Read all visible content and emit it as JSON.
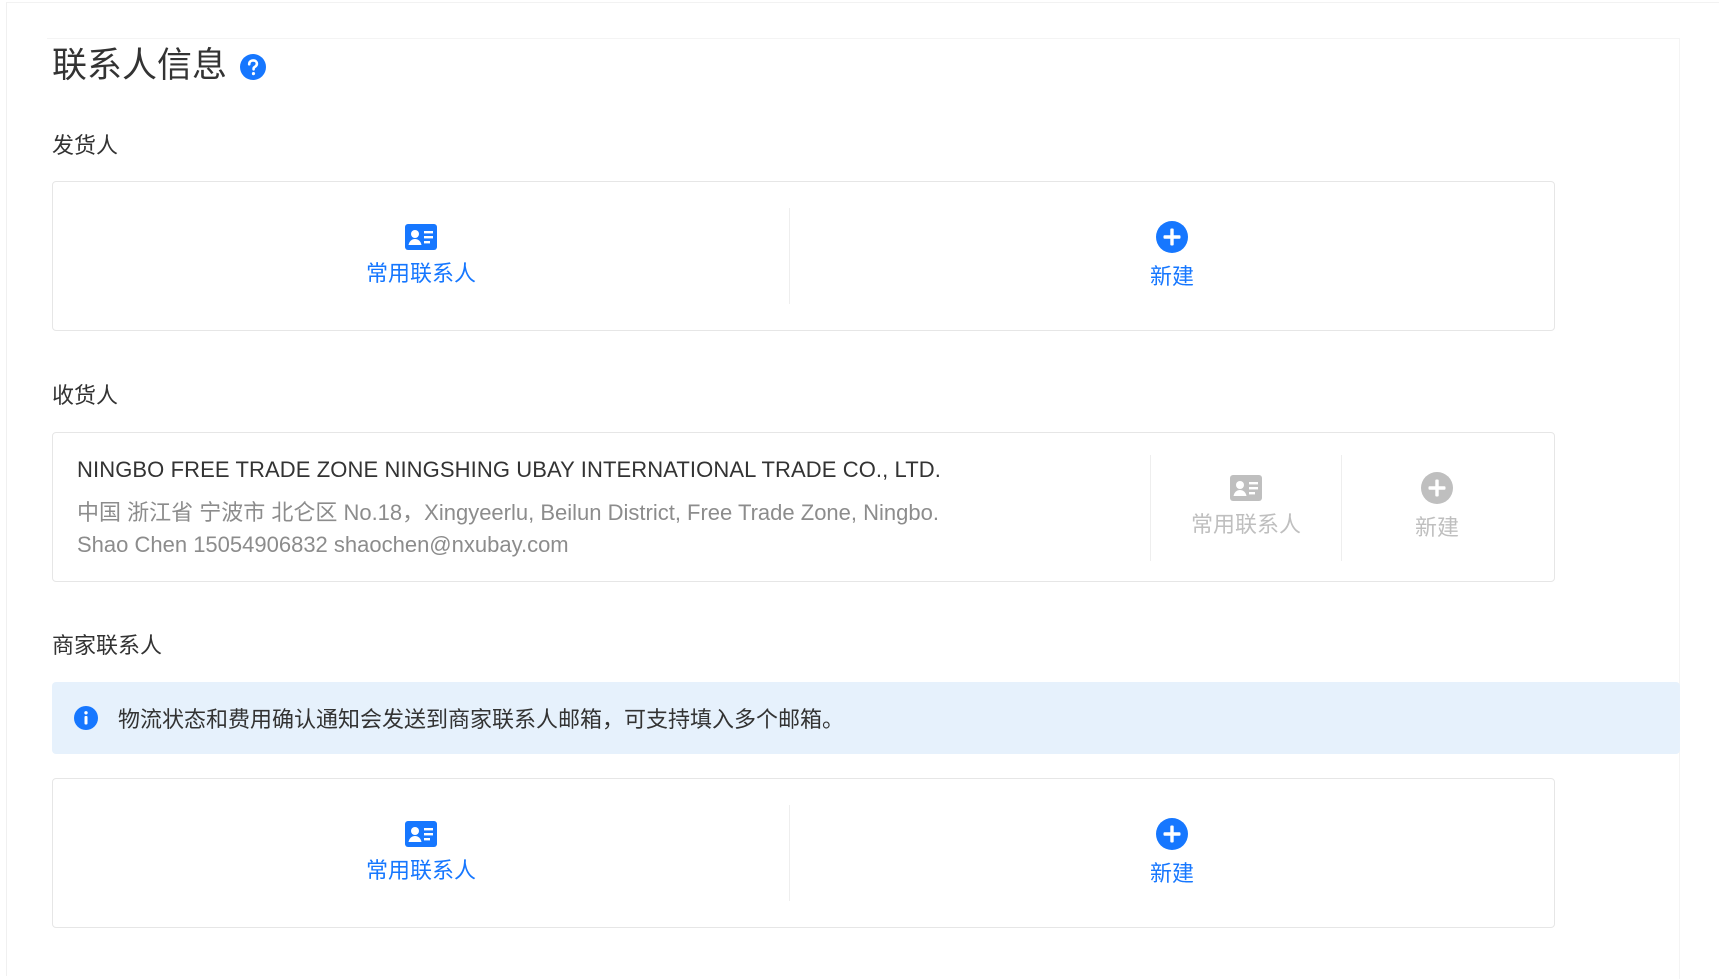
{
  "section": {
    "title": "联系人信息",
    "help_icon": "question-circle-icon"
  },
  "shipper": {
    "label": "发货人",
    "frequent_label": "常用联系人",
    "new_label": "新建"
  },
  "consignee": {
    "label": "收货人",
    "company": "NINGBO FREE TRADE ZONE NINGSHING UBAY INTERNATIONAL TRADE CO., LTD.",
    "address": "中国 浙江省 宁波市 北仑区 No.18，Xingyeerlu, Beilun District, Free Trade Zone, Ningbo.",
    "person": "Shao Chen 15054906832 shaochen@nxubay.com",
    "frequent_label": "常用联系人",
    "new_label": "新建"
  },
  "merchant": {
    "label": "商家联系人",
    "notice": "物流状态和费用确认通知会发送到商家联系人邮箱，可支持填入多个邮箱。",
    "frequent_label": "常用联系人",
    "new_label": "新建"
  },
  "colors": {
    "primary": "#1677ff",
    "disabled": "#bfbfbf",
    "notice_bg": "#e6f1fc",
    "border": "#e6e6e6",
    "text": "#333333",
    "muted": "#8c8c8c"
  },
  "icons": {
    "contact_card": "contact-card-icon",
    "add": "plus-circle-icon",
    "info": "info-circle-icon"
  }
}
